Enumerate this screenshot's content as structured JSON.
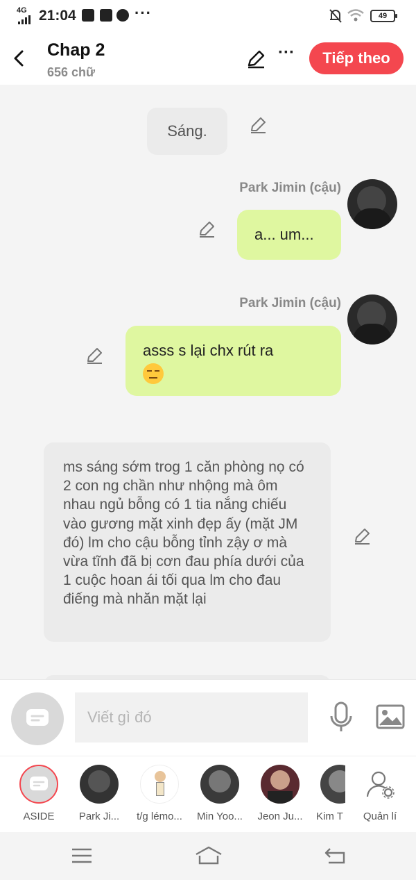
{
  "status_bar": {
    "network": "4G",
    "time": "21:04",
    "battery": "49",
    "icons": [
      "mail-icon",
      "facebook-icon",
      "chat-icon",
      "mute-icon",
      "wifi-icon"
    ]
  },
  "header": {
    "title": "Chap 2",
    "word_count": "656 chữ",
    "next_label": "Tiếp theo",
    "accent_color": "#f4474f"
  },
  "messages": [
    {
      "type": "narration",
      "text": "Sáng."
    },
    {
      "type": "character",
      "speaker": "Park Jimin (cậu)",
      "text": "a... um..."
    },
    {
      "type": "character",
      "speaker": "Park Jimin (cậu)",
      "text": "asss s lại chx rút ra",
      "emoji": "unamused-face"
    },
    {
      "type": "narration",
      "text": "ms sáng sớm trog 1 căn phòng nọ có 2 con ng chần như nhộng mà ôm nhau ngủ bỗng có 1 tia nắng chiếu vào gương mặt xinh đẹp ấy (mặt JM đó) lm cho cậu bỗng tỉnh zậy ơ mà vừa tĩnh đã bị cơn đau phía dưới của 1 cuộc hoan ái tối qua lm cho đau điếng mà nhăn mặt lại"
    }
  ],
  "compose": {
    "placeholder": "Viết gì đó"
  },
  "characters": [
    {
      "name": "ASIDE"
    },
    {
      "name": "Park Ji..."
    },
    {
      "name": "t/g lémo..."
    },
    {
      "name": "Min Yoo..."
    },
    {
      "name": "Jeon Ju..."
    },
    {
      "name": "Kim T"
    },
    {
      "name": "Quản lí"
    }
  ],
  "colors": {
    "character_bubble": "#dff7a0",
    "narration_bubble": "#ebebeb",
    "background": "#f4f4f4"
  }
}
